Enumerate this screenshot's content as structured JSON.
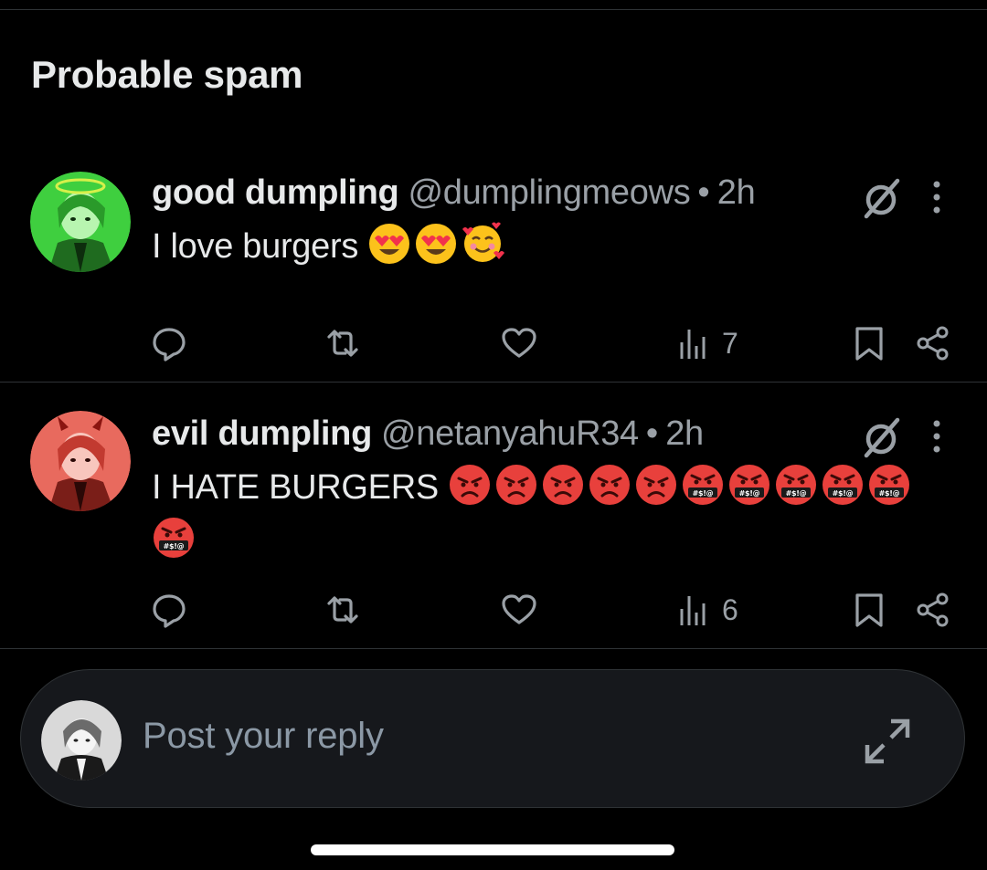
{
  "section": {
    "title": "Probable spam"
  },
  "posts": [
    {
      "display_name": "good dumpling",
      "handle": "@dumplingmeows",
      "separator": "•",
      "time": "2h",
      "text": "I love burgers",
      "emojis": [
        "heart-eyes",
        "heart-eyes",
        "smiling-with-hearts"
      ],
      "views": "7",
      "avatar_tint": "#4ad24a"
    },
    {
      "display_name": "evil dumpling",
      "handle": "@netanyahuR34",
      "separator": "•",
      "time": "2h",
      "text": "I HATE BURGERS",
      "emojis": [
        "pouting-face",
        "pouting-face",
        "pouting-face",
        "pouting-face",
        "pouting-face",
        "cursing-face",
        "cursing-face",
        "cursing-face",
        "cursing-face",
        "cursing-face",
        "cursing-face"
      ],
      "views": "6",
      "avatar_tint": "#e05a52"
    }
  ],
  "reply": {
    "placeholder": "Post your reply"
  },
  "colors": {
    "background": "#000000",
    "text_primary": "#e7e9ea",
    "text_secondary": "#9aa0a6",
    "divider": "#2f3336",
    "reply_bar": "#16181c"
  },
  "icons": [
    "hide-reply-icon",
    "more-icon",
    "reply-icon",
    "repost-icon",
    "like-icon",
    "views-icon",
    "bookmark-icon",
    "share-icon",
    "expand-icon"
  ]
}
